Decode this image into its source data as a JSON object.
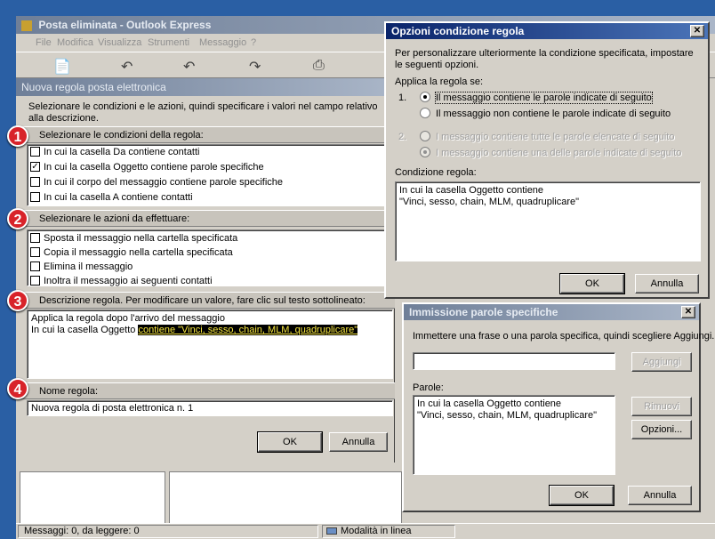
{
  "background": {
    "accent": "#2a5fa4"
  },
  "main_window": {
    "title": "Posta eliminata - Outlook Express",
    "menu": [
      "File",
      "Modifica",
      "Visualizza",
      "Strumenti",
      "Messaggio",
      "?"
    ],
    "toolbar_icons": [
      "new-message-icon",
      "reply-icon",
      "reply-all-icon",
      "forward-icon",
      "print-icon"
    ]
  },
  "rule_dialog": {
    "title": "Nuova regola posta elettronica",
    "intro": "Selezionare le condizioni e le azioni, quindi specificare i valori nel campo relativo alla descrizione.",
    "step1_label": "Selezionare le condizioni della regola:",
    "conditions": [
      {
        "label": "In cui la casella Da contiene contatti",
        "checked": false
      },
      {
        "label": "In cui la casella Oggetto contiene parole specifiche",
        "checked": true
      },
      {
        "label": "In cui il corpo del messaggio contiene parole specifiche",
        "checked": false
      },
      {
        "label": "In cui la casella A contiene contatti",
        "checked": false
      }
    ],
    "step2_label": "Selezionare le azioni da effettuare:",
    "actions": [
      {
        "label": "Sposta il messaggio nella cartella specificata",
        "checked": false
      },
      {
        "label": "Copia il messaggio nella cartella specificata",
        "checked": false
      },
      {
        "label": "Elimina il messaggio",
        "checked": false
      },
      {
        "label": "Inoltra il messaggio ai seguenti contatti",
        "checked": false
      }
    ],
    "step3_label": "Descrizione regola. Per modificare un valore, fare clic sul testo sottolineato:",
    "description_line1": "Applica la regola dopo l'arrivo del messaggio",
    "description_line2_prefix": "In cui la casella Oggetto ",
    "description_link": "contiene \"Vinci, sesso, chain, MLM, quadruplicare\"",
    "step4_label": "Nome regola:",
    "rule_name": "Nuova regola di posta elettronica n. 1",
    "ok": "OK",
    "cancel": "Annulla",
    "badges": [
      "1",
      "2",
      "3",
      "4"
    ]
  },
  "options_dialog": {
    "title": "Opzioni condizione regola",
    "intro": "Per personalizzare ulteriormente la condizione specificata, impostare le seguenti opzioni.",
    "apply_label": "Applica la regola se:",
    "group1_num": "1.",
    "radio1a": "Il messaggio contiene le parole indicate di seguito",
    "radio1b": "Il messaggio non contiene le parole indicate di seguito",
    "group2_num": "2.",
    "radio2a": "I messaggio contiene tutte le parole elencate di seguito",
    "radio2b": "I messaggio contiene una delle parole indicate di seguito",
    "condition_label": "Condizione regola:",
    "condition_line1": "In cui la casella Oggetto contiene",
    "condition_line2": "\"Vinci, sesso, chain, MLM, quadruplicare\"",
    "ok": "OK",
    "cancel": "Annulla"
  },
  "words_dialog": {
    "title": "Immissione parole specifiche",
    "intro": "Immettere una frase o una parola specifica, quindi scegliere Aggiungi.",
    "add": "Aggiungi",
    "words_label": "Parole:",
    "words_line1": "In cui la casella Oggetto contiene",
    "words_line2": "\"Vinci, sesso, chain, MLM, quadruplicare\"",
    "remove": "Rimuovi",
    "options": "Opzioni...",
    "ok": "OK",
    "cancel": "Annulla"
  },
  "status_bar": {
    "messages": "Messaggi: 0, da leggere: 0",
    "mode": "Modalità in linea"
  }
}
